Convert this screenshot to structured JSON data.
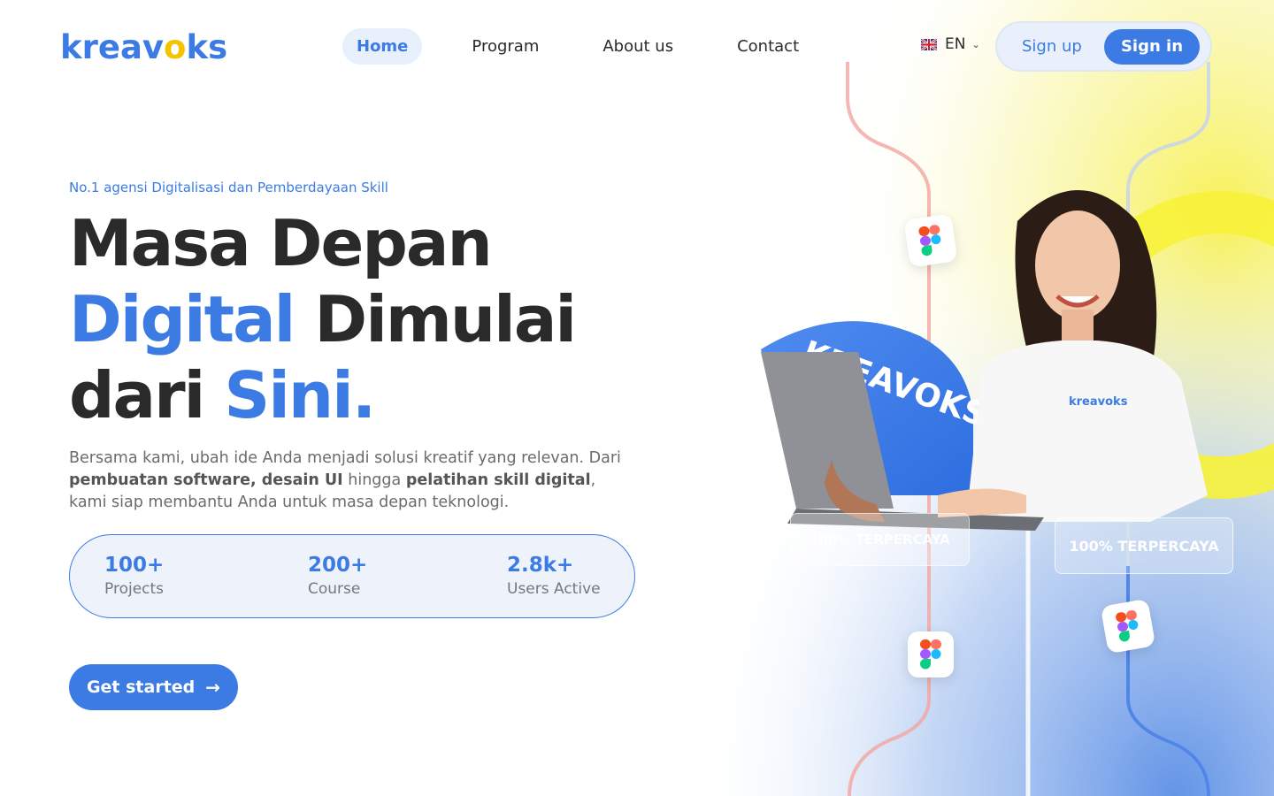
{
  "header": {
    "logo": {
      "before": "kreav",
      "o": "o",
      "after": "ks"
    },
    "nav": [
      {
        "label": "Home",
        "active": true
      },
      {
        "label": "Program"
      },
      {
        "label": "About us"
      },
      {
        "label": "Contact"
      }
    ],
    "language": {
      "code": "EN",
      "flag_icon": "uk-flag-icon"
    },
    "sign_up": "Sign up",
    "sign_in": "Sign in"
  },
  "hero": {
    "eyebrow": "No.1 agensi Digitalisasi dan Pemberdayaan Skill",
    "headline": {
      "line1": "Masa Depan",
      "line2_blue": "Digital",
      "line2_rest": " Dimulai",
      "line3_dark": "dari ",
      "line3_blue": "Sini."
    },
    "description": {
      "p1": "Bersama kami, ubah ide Anda menjadi solusi kreatif yang relevan. Dari ",
      "b1": "pembuatan software, desain UI",
      "p2": " hingga ",
      "b2": "pelatihan skill digital",
      "p3": ", kami siap membantu Anda untuk masa depan teknologi."
    },
    "stats": [
      {
        "value": "100+",
        "label": "Projects"
      },
      {
        "value": "200+",
        "label": "Course"
      },
      {
        "value": "2.8k+",
        "label": "Users Active"
      }
    ],
    "cta": "Get started"
  },
  "art": {
    "badge_left": "100% TERPERCAYA",
    "badge_right": "100% TERPERCAYA",
    "arc_text": "KREAVOKS",
    "shirt_logo": "kreavoks",
    "icons": [
      "figma-icon",
      "figma-icon",
      "figma-icon"
    ]
  },
  "colors": {
    "accent": "#3b7be3",
    "yellow": "#f5e33a",
    "dark": "#2a2a2a",
    "muted": "#6b6b6b"
  }
}
